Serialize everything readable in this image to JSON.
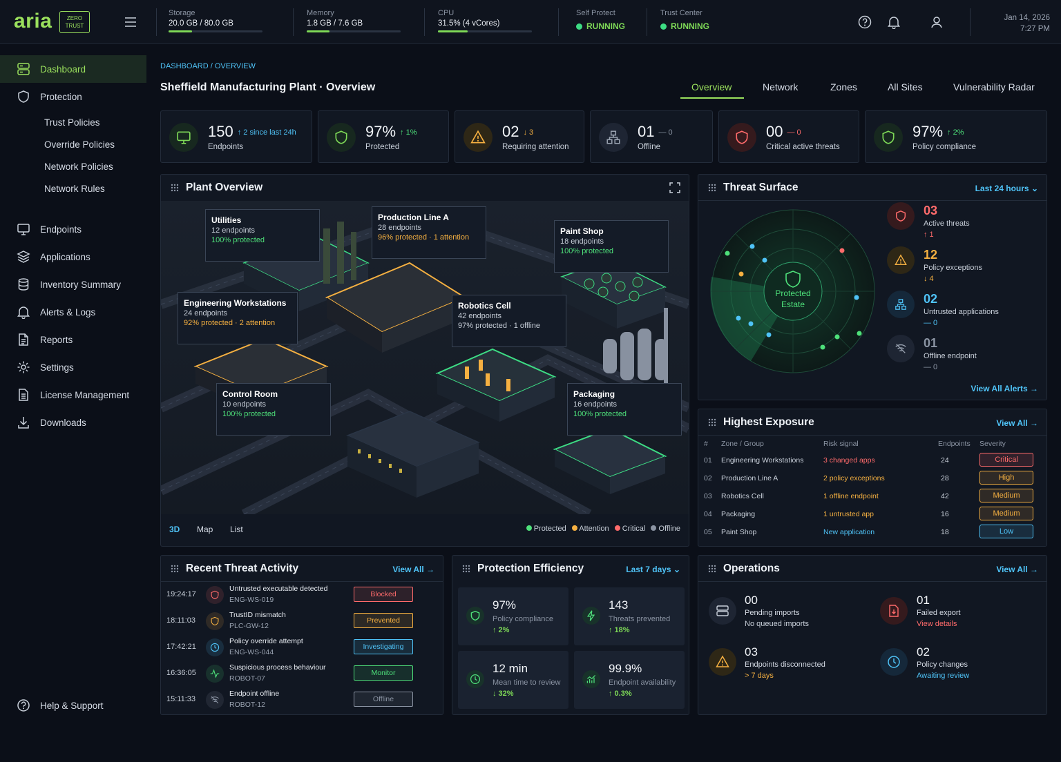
{
  "brand": {
    "logo": "aria",
    "badge_line1": "ZERO",
    "badge_line2": "TRUST"
  },
  "topbar": {
    "storage": {
      "label": "Storage",
      "value": "20.0 GB / 80.0 GB",
      "fill": 0.25
    },
    "memory": {
      "label": "Memory",
      "value": "1.8 GB / 7.6 GB",
      "fill": 0.24
    },
    "cpu": {
      "label": "CPU",
      "value": "31.5% (4 vCores)",
      "fill": 0.315
    },
    "self_protect": {
      "label": "Self Protect",
      "status": "RUNNING"
    },
    "trust_center": {
      "label": "Trust Center",
      "status": "RUNNING"
    },
    "date": "Jan 14, 2026",
    "time": "7:27 PM"
  },
  "sidebar": {
    "items": [
      {
        "label": "Dashboard",
        "icon": "server-stack-icon"
      },
      {
        "label": "Protection",
        "icon": "shield-icon"
      },
      {
        "label": "Endpoints",
        "icon": "monitor-icon"
      },
      {
        "label": "Applications",
        "icon": "layers-icon"
      },
      {
        "label": "Inventory Summary",
        "icon": "database-icon"
      },
      {
        "label": "Alerts & Logs",
        "icon": "bell-icon"
      },
      {
        "label": "Reports",
        "icon": "document-icon"
      },
      {
        "label": "Settings",
        "icon": "gear-icon"
      },
      {
        "label": "License Management",
        "icon": "license-icon"
      },
      {
        "label": "Downloads",
        "icon": "download-icon"
      }
    ],
    "protection_sub": [
      "Trust Policies",
      "Override Policies",
      "Network Policies",
      "Network Rules"
    ],
    "help": "Help & Support"
  },
  "header": {
    "breadcrumb": "DASHBOARD / OVERVIEW",
    "title": "Sheffield Manufacturing Plant · Overview",
    "tabs": [
      "Overview",
      "Network",
      "Zones",
      "All Sites",
      "Vulnerability Radar"
    ],
    "active_tab": "Overview"
  },
  "kpis": [
    {
      "value": "150",
      "change": "↑ 2 since last 24h",
      "caption": "Endpoints",
      "color": "#7ed957"
    },
    {
      "value": "97%",
      "change": "↑ 1%",
      "caption": "Protected",
      "color": "#7ed957"
    },
    {
      "value": "02",
      "change": "↓ 3",
      "caption": "Requiring attention",
      "color": "#f5b041"
    },
    {
      "value": "01",
      "change": "— 0",
      "caption": "Offline",
      "color": "#8b94a3"
    },
    {
      "value": "00",
      "change": "— 0",
      "caption": "Critical active threats",
      "color": "#ff6b6b"
    },
    {
      "value": "97%",
      "change": "↑ 2%",
      "caption": "Policy compliance",
      "color": "#7ed957"
    }
  ],
  "plant": {
    "title": "Plant Overview",
    "zones": [
      {
        "name": "Utilities",
        "endpoints": "12 endpoints",
        "status": "100% protected",
        "state": "g"
      },
      {
        "name": "Production Line A",
        "endpoints": "28 endpoints",
        "status": "96% protected · 1 attention",
        "state": "o"
      },
      {
        "name": "Paint Shop",
        "endpoints": "18 endpoints",
        "status": "100% protected",
        "state": "g"
      },
      {
        "name": "Engineering Workstations",
        "endpoints": "24 endpoints",
        "status": "92% protected · 2 attention",
        "state": "o"
      },
      {
        "name": "Robotics Cell",
        "endpoints": "42 endpoints",
        "status": "97% protected · 1 offline",
        "state": "m"
      },
      {
        "name": "Control Room",
        "endpoints": "10 endpoints",
        "status": "100% protected",
        "state": "g"
      },
      {
        "name": "Packaging",
        "endpoints": "16 endpoints",
        "status": "100% protected",
        "state": "g"
      }
    ],
    "views": [
      "3D",
      "Map",
      "List"
    ],
    "legend": [
      "Protected",
      "Attention",
      "Critical",
      "Offline"
    ]
  },
  "threat_surface": {
    "title": "Threat Surface",
    "range": "Last 24 hours",
    "center_line1": "Protected",
    "center_line2": "Estate",
    "items": [
      {
        "value": "03",
        "label": "Active threats",
        "change": "↑ 1",
        "color": "#ff6b6b",
        "icon": "shield-icon"
      },
      {
        "value": "12",
        "label": "Policy exceptions",
        "change": "↓ 4",
        "color": "#f5b041",
        "icon": "warning-icon"
      },
      {
        "value": "02",
        "label": "Untrusted applications",
        "change": "— 0",
        "color": "#4fc3f7",
        "icon": "network-tree-icon"
      },
      {
        "value": "01",
        "label": "Offline endpoint",
        "change": "— 0",
        "color": "#8b94a3",
        "icon": "wifi-off-icon"
      }
    ],
    "view_all": "View All Alerts →"
  },
  "exposure": {
    "title": "Highest Exposure",
    "view_all": "View All →",
    "headers": [
      "#",
      "Zone / Group",
      "Risk signal",
      "Endpoints",
      "Severity"
    ],
    "rows": [
      {
        "n": "01",
        "zone": "Engineering Workstations",
        "signal": "3 changed apps",
        "endpoints": "24",
        "severity": "Critical",
        "color": "#ff6b6b"
      },
      {
        "n": "02",
        "zone": "Production Line A",
        "signal": "2 policy exceptions",
        "endpoints": "28",
        "severity": "High",
        "color": "#f5b041"
      },
      {
        "n": "03",
        "zone": "Robotics Cell",
        "signal": "1 offline endpoint",
        "endpoints": "42",
        "severity": "Medium",
        "color": "#f5b041"
      },
      {
        "n": "04",
        "zone": "Packaging",
        "signal": "1 untrusted app",
        "endpoints": "16",
        "severity": "Medium",
        "color": "#f5b041"
      },
      {
        "n": "05",
        "zone": "Paint Shop",
        "signal": "New application",
        "endpoints": "18",
        "severity": "Low",
        "color": "#4fc3f7"
      }
    ]
  },
  "activity": {
    "title": "Recent Threat Activity",
    "view_all": "View All →",
    "rows": [
      {
        "time": "19:24:17",
        "title": "Untrusted executable detected",
        "host": "ENG-WS-019",
        "status": "Blocked",
        "color": "#ff6b6b"
      },
      {
        "time": "18:11:03",
        "title": "TrustID mismatch",
        "host": "PLC-GW-12",
        "status": "Prevented",
        "color": "#f5b041"
      },
      {
        "time": "17:42:21",
        "title": "Policy override attempt",
        "host": "ENG-WS-044",
        "status": "Investigating",
        "color": "#4fc3f7"
      },
      {
        "time": "16:36:05",
        "title": "Suspicious process behaviour",
        "host": "ROBOT-07",
        "status": "Monitor",
        "color": "#4ee07a"
      },
      {
        "time": "15:11:33",
        "title": "Endpoint offline",
        "host": "ROBOT-12",
        "status": "Offline",
        "color": "#8b94a3"
      }
    ]
  },
  "efficiency": {
    "title": "Protection Efficiency",
    "range": "Last 7 days",
    "cards": [
      {
        "value": "97%",
        "label": "Policy compliance",
        "change": "↑ 2%"
      },
      {
        "value": "143",
        "label": "Threats prevented",
        "change": "↑ 18%"
      },
      {
        "value": "12 min",
        "label": "Mean time to review",
        "change": "↓ 32%"
      },
      {
        "value": "99.9%",
        "label": "Endpoint availability",
        "change": "↑ 0.3%"
      }
    ]
  },
  "operations": {
    "title": "Operations",
    "view_all": "View All →",
    "items": [
      {
        "value": "00",
        "label": "Pending imports",
        "sub": "No queued imports",
        "sub_color": "#c9d0da"
      },
      {
        "value": "01",
        "label": "Failed export",
        "sub": "View details",
        "sub_color": "#ff6b6b"
      },
      {
        "value": "03",
        "label": "Endpoints disconnected",
        "sub": "> 7 days",
        "sub_color": "#f5b041"
      },
      {
        "value": "02",
        "label": "Policy changes",
        "sub": "Awaiting review",
        "sub_color": "#4fc3f7"
      }
    ]
  }
}
